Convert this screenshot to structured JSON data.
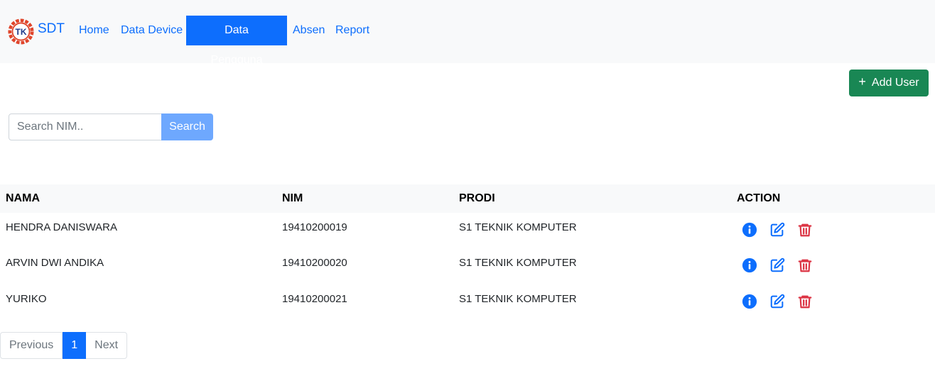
{
  "navbar": {
    "brand": "SDT",
    "logo_text": "TK",
    "items": [
      {
        "label": "Home",
        "active": false
      },
      {
        "label": "Data Device",
        "active": false
      },
      {
        "label": "Data Pengguna",
        "active": true
      },
      {
        "label": "Absen",
        "active": false
      },
      {
        "label": "Report",
        "active": false
      }
    ]
  },
  "toolbar": {
    "add_user_icon": "+",
    "add_user_label": "Add User"
  },
  "search": {
    "placeholder": "Search NIM..",
    "value": "",
    "button_label": "Search"
  },
  "table": {
    "headers": [
      "NAMA",
      "NIM",
      "PRODI",
      "ACTION"
    ],
    "rows": [
      {
        "nama": "HENDRA DANISWARA",
        "nim": "19410200019",
        "prodi": "S1 TEKNIK KOMPUTER"
      },
      {
        "nama": "ARVIN DWI ANDIKA",
        "nim": "19410200020",
        "prodi": "S1 TEKNIK KOMPUTER"
      },
      {
        "nama": "YURIKO",
        "nim": "19410200021",
        "prodi": "S1 TEKNIK KOMPUTER"
      }
    ],
    "action_icons": [
      "info-icon",
      "edit-icon",
      "trash-icon"
    ]
  },
  "pagination": {
    "previous_label": "Previous",
    "current_page": "1",
    "next_label": "Next"
  },
  "colors": {
    "primary": "#0d6efd",
    "success": "#198754",
    "danger": "#dc3545",
    "search_button": "#6ea8fe"
  }
}
